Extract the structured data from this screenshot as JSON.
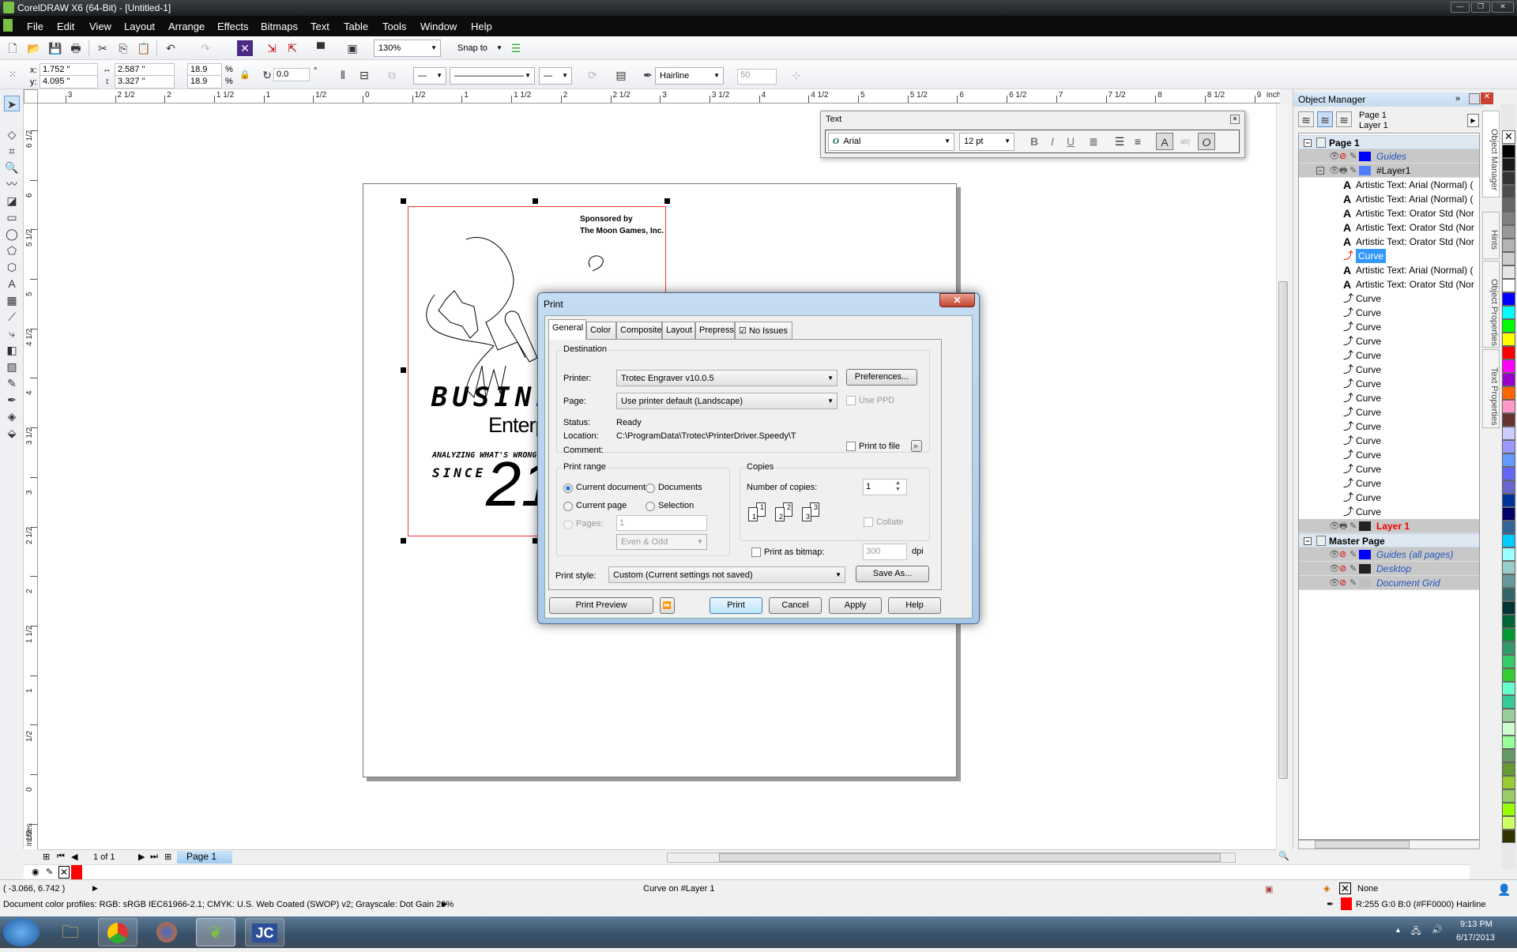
{
  "window": {
    "title": "CorelDRAW X6 (64-Bit) - [Untitled-1]"
  },
  "menu": [
    "File",
    "Edit",
    "View",
    "Layout",
    "Arrange",
    "Effects",
    "Bitmaps",
    "Text",
    "Table",
    "Tools",
    "Window",
    "Help"
  ],
  "standard_toolbar": {
    "zoom": "130%",
    "snap_to": "Snap to"
  },
  "property_bar": {
    "x": "1.752 \"",
    "y": "4.095 \"",
    "width": "2.587 \"",
    "height": "3.327 \"",
    "scale_x": "18.9",
    "scale_y": "18.9",
    "pct": "%",
    "rotation": "0.0",
    "deg": "°",
    "outline": "Hairline",
    "miter": "50"
  },
  "ruler": {
    "h_labels": [
      "3",
      "2 1/2",
      "2",
      "1 1/2",
      "1",
      "1/2",
      "0",
      "1/2",
      "1",
      "1 1/2",
      "2",
      "2 1/2",
      "3",
      "3 1/2",
      "4",
      "4 1/2",
      "5",
      "5 1/2",
      "6",
      "6 1/2",
      "7",
      "7 1/2",
      "8",
      "8 1/2",
      "9"
    ],
    "units": "inches",
    "v_labels": [
      "6 1/2",
      "6",
      "5 1/2",
      "5",
      "4 1/2",
      "4",
      "3 1/2",
      "3",
      "2 1/2",
      "2",
      "1 1/2",
      "1",
      "1/2",
      "0",
      "1/2"
    ]
  },
  "artwork": {
    "sponsor1": "Sponsored by",
    "sponsor2": "The Moon Games, Inc.",
    "title1": "BUSINES",
    "title2": "Enterp",
    "tagline": "ANALYZING WHAT'S WRONG W",
    "since": "SINCE",
    "year": "21"
  },
  "text_toolbar": {
    "title": "Text",
    "font": "Arial",
    "size": "12 pt"
  },
  "print_dialog": {
    "title": "Print",
    "tabs": [
      "General",
      "Color",
      "Composite",
      "Layout",
      "Prepress",
      "No Issues"
    ],
    "destination": {
      "legend": "Destination",
      "printer_label": "Printer:",
      "printer": "Trotec Engraver v10.0.5",
      "preferences": "Preferences...",
      "page_label": "Page:",
      "page": "Use printer default (Landscape)",
      "use_ppd": "Use PPD",
      "status_label": "Status:",
      "status": "Ready",
      "location_label": "Location:",
      "location": "C:\\ProgramData\\Trotec\\PrinterDriver.Speedy\\T",
      "comment_label": "Comment:",
      "print_to_file": "Print to file"
    },
    "range": {
      "legend": "Print range",
      "current_document": "Current document",
      "documents": "Documents",
      "current_page": "Current page",
      "selection": "Selection",
      "pages_label": "Pages:",
      "pages": "1",
      "even_odd": "Even & Odd",
      "selected": "Current document"
    },
    "copies": {
      "legend": "Copies",
      "label": "Number of copies:",
      "value": "1",
      "collate": "Collate",
      "icon_numbers": [
        "1",
        "1",
        "2",
        "2",
        "3",
        "3"
      ]
    },
    "bitmap": {
      "label": "Print as bitmap:",
      "dpi_value": "300",
      "dpi": "dpi"
    },
    "style": {
      "label": "Print style:",
      "value": "Custom (Current settings not saved)",
      "save_as": "Save As..."
    },
    "buttons": {
      "preview": "Print Preview",
      "print": "Print",
      "cancel": "Cancel",
      "apply": "Apply",
      "help": "Help"
    }
  },
  "object_manager": {
    "title": "Object Manager",
    "page": "Page 1",
    "layer": "Layer 1",
    "rows": [
      {
        "label": "Page 1",
        "kind": "page"
      },
      {
        "label": "Guides",
        "kind": "layer",
        "color": "#0000ff",
        "italic": true
      },
      {
        "label": "#Layer1",
        "kind": "layer",
        "color": "#4f7fff"
      },
      {
        "label": "Artistic Text: Arial (Normal) (",
        "kind": "text"
      },
      {
        "label": "Artistic Text: Arial (Normal) (",
        "kind": "text"
      },
      {
        "label": "Artistic Text: Orator Std (Nor",
        "kind": "text"
      },
      {
        "label": "Artistic Text: Orator Std (Nor",
        "kind": "text"
      },
      {
        "label": "Artistic Text: Orator Std (Nor",
        "kind": "text"
      },
      {
        "label": "Curve",
        "kind": "curve",
        "selected": true
      },
      {
        "label": "Artistic Text: Arial (Normal) (",
        "kind": "text"
      },
      {
        "label": "Artistic Text: Orator Std (Nor",
        "kind": "text"
      },
      {
        "label": "Curve",
        "kind": "curve"
      },
      {
        "label": "Curve",
        "kind": "curve"
      },
      {
        "label": "Curve",
        "kind": "curve"
      },
      {
        "label": "Curve",
        "kind": "curve"
      },
      {
        "label": "Curve",
        "kind": "curve"
      },
      {
        "label": "Curve",
        "kind": "curve"
      },
      {
        "label": "Curve",
        "kind": "curve"
      },
      {
        "label": "Curve",
        "kind": "curve"
      },
      {
        "label": "Curve",
        "kind": "curve"
      },
      {
        "label": "Curve",
        "kind": "curve"
      },
      {
        "label": "Curve",
        "kind": "curve"
      },
      {
        "label": "Curve",
        "kind": "curve"
      },
      {
        "label": "Curve",
        "kind": "curve"
      },
      {
        "label": "Curve",
        "kind": "curve"
      },
      {
        "label": "Curve",
        "kind": "curve"
      },
      {
        "label": "Curve",
        "kind": "curve"
      },
      {
        "label": "Layer 1",
        "kind": "layer",
        "color": "#222222",
        "red": true
      },
      {
        "label": "Master Page",
        "kind": "page"
      },
      {
        "label": "Guides (all pages)",
        "kind": "layer",
        "color": "#0000ff",
        "italic": true,
        "blue": true
      },
      {
        "label": "Desktop",
        "kind": "layer",
        "color": "#222222",
        "italic": true,
        "blue": true
      },
      {
        "label": "Document Grid",
        "kind": "layer",
        "color": "#c0c0c0",
        "italic": true,
        "blue": true
      }
    ]
  },
  "docker_tabs": [
    "Object Manager",
    "Hints",
    "Object Properties",
    "Text Properties"
  ],
  "palette": [
    "#000000",
    "#1a1a1a",
    "#333333",
    "#4d4d4d",
    "#666666",
    "#808080",
    "#999999",
    "#b3b3b3",
    "#cccccc",
    "#e6e6e6",
    "#ffffff",
    "#0000ff",
    "#00ffff",
    "#00ff00",
    "#ffff00",
    "#ff0000",
    "#ff00ff",
    "#9900cc",
    "#ff6600",
    "#ff99cc",
    "#663333",
    "#ccccff",
    "#9999ff",
    "#6699ff",
    "#6666ff",
    "#6666cc",
    "#003399",
    "#000066",
    "#336699",
    "#00ccff",
    "#99ffff",
    "#99cccc",
    "#669999",
    "#336666",
    "#003333",
    "#006633",
    "#009933",
    "#339966",
    "#33cc66",
    "#33cc33",
    "#66ffcc",
    "#33cc99",
    "#99cc99",
    "#ccffcc",
    "#99ff99",
    "#669966",
    "#669933",
    "#99cc33",
    "#99cc66",
    "#99ff00",
    "#ccff66",
    "#333300"
  ],
  "page_nav": {
    "count": "1 of 1",
    "tab": "Page 1"
  },
  "status": {
    "coords": "( -3.066, 6.742 )",
    "selection": "Curve on #Layer 1",
    "profiles": "Document color profiles: RGB: sRGB IEC61966-2.1; CMYK: U.S. Web Coated (SWOP) v2; Grayscale: Dot Gain 20%",
    "fill": "None",
    "outline": "R:255 G:0 B:0 (#FF0000)  Hairline",
    "outline_color": "#ff0000"
  },
  "taskbar": {
    "time": "9:13 PM",
    "date": "6/17/2013"
  }
}
